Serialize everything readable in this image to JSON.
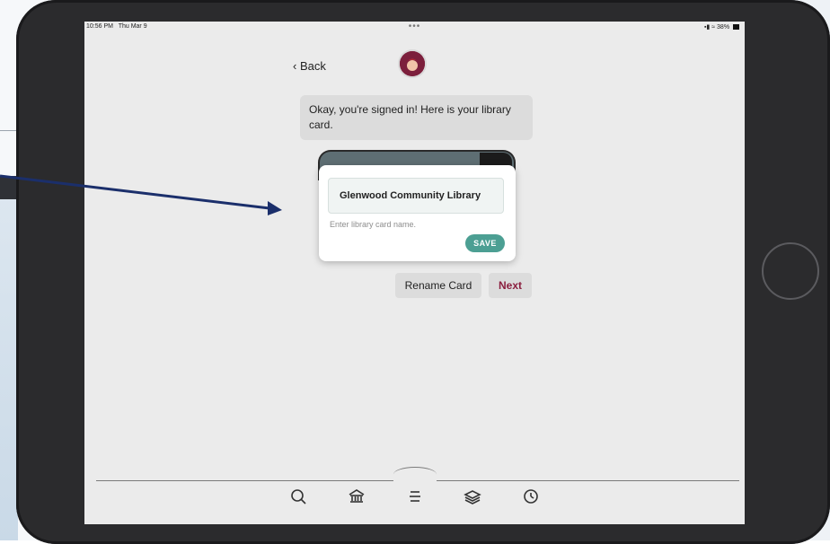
{
  "status_bar": {
    "time": "10:56 PM",
    "date": "Thu Mar 9",
    "center_dots": "•••",
    "battery": "38%"
  },
  "header": {
    "back_label": "Back"
  },
  "chat": {
    "message": "Okay, you're signed in! Here is your library card."
  },
  "modal": {
    "input_value": "Glenwood Community Library",
    "help_text": "Enter library card name.",
    "save_label": "SAVE"
  },
  "actions": {
    "rename_label": "Rename Card",
    "next_label": "Next"
  },
  "bottom_nav": {
    "items": [
      "search-icon",
      "library-icon",
      "menu-icon",
      "stack-icon",
      "clock-icon"
    ]
  },
  "colors": {
    "accent_teal": "#4c9f93",
    "accent_maroon": "#8b1f3f",
    "arrow": "#1b2f6b"
  }
}
